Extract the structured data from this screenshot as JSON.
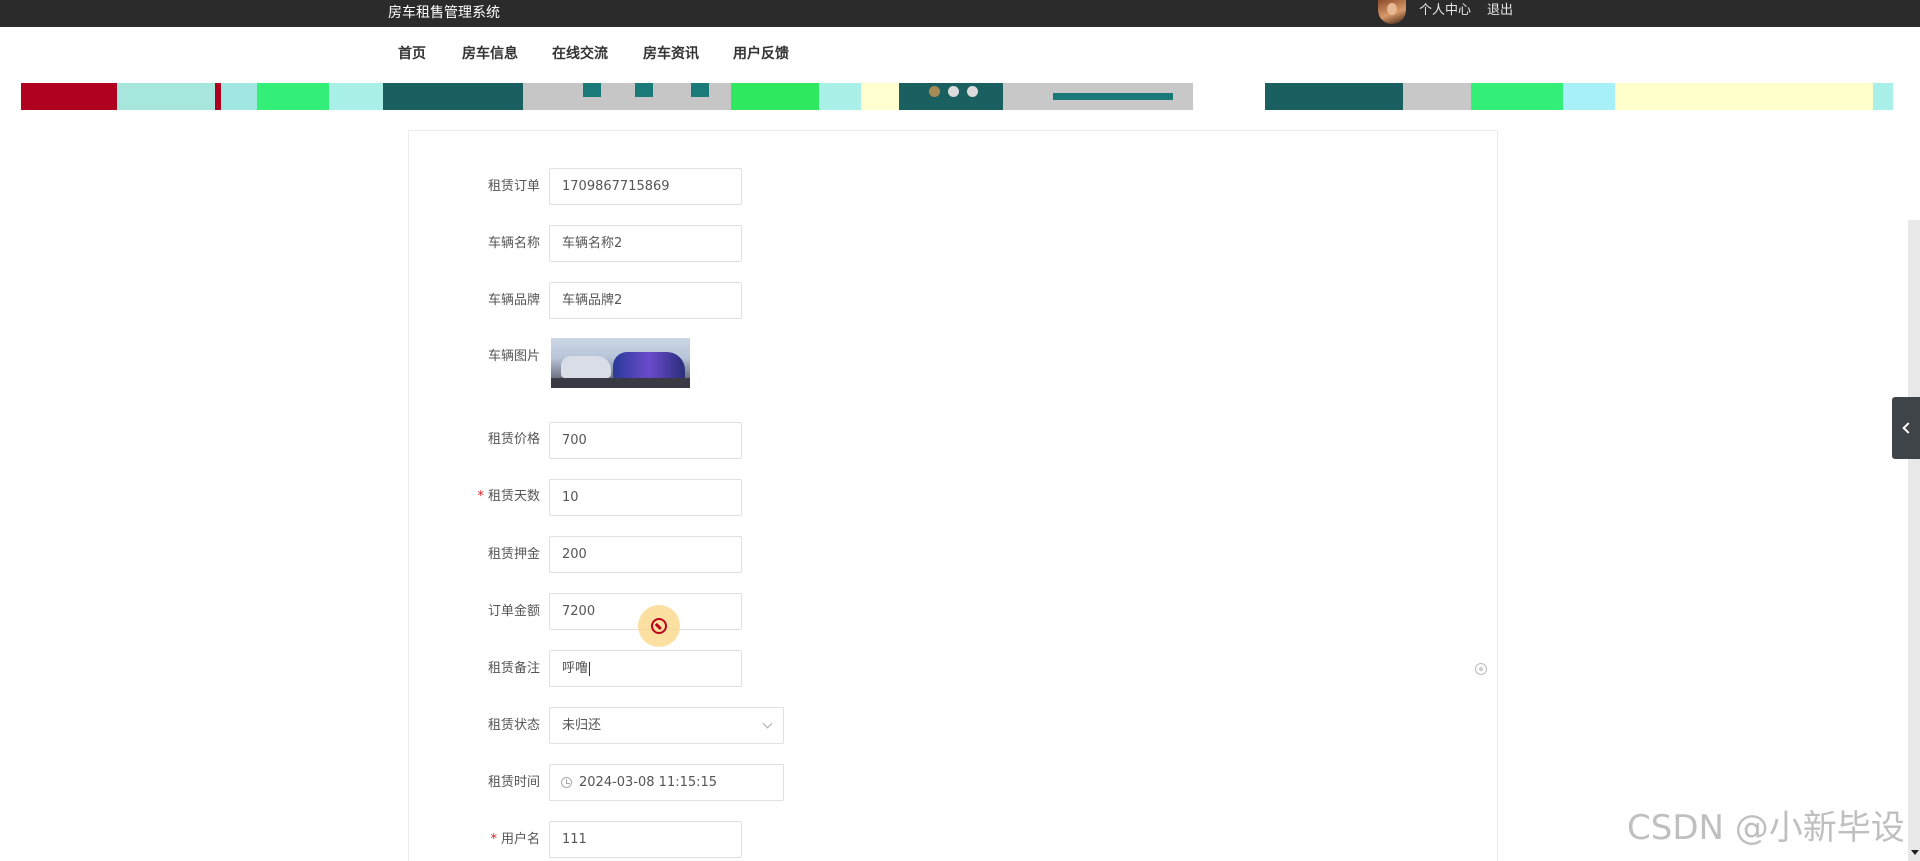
{
  "topbar": {
    "system_title": "房车租售管理系统",
    "personal_center": "个人中心",
    "logout": "退出"
  },
  "nav": {
    "items": [
      "首页",
      "房车信息",
      "在线交流",
      "房车资讯",
      "用户反馈"
    ]
  },
  "banner": {
    "dots": 3,
    "active_dot": 0
  },
  "form": {
    "fields": [
      {
        "label": "租赁订单",
        "value": "1709867715869",
        "required": false
      },
      {
        "label": "车辆名称",
        "value": "车辆名称2",
        "required": false
      },
      {
        "label": "车辆品牌",
        "value": "车辆品牌2",
        "required": false
      },
      {
        "label": "车辆图片",
        "required": false
      },
      {
        "label": "租赁价格",
        "value": "700",
        "required": false
      },
      {
        "label": "租赁天数",
        "value": "10",
        "required": true
      },
      {
        "label": "租赁押金",
        "value": "200",
        "required": false
      },
      {
        "label": "订单金额",
        "value": "7200",
        "required": false
      },
      {
        "label": "租赁备注",
        "value": "呼噜",
        "required": false
      },
      {
        "label": "租赁状态",
        "value": "未归还",
        "required": false
      },
      {
        "label": "租赁时间",
        "value": "2024-03-08 11:15:15",
        "required": false
      },
      {
        "label": "用户名",
        "value": "111",
        "required": true
      }
    ],
    "required_mark": "*"
  },
  "watermark": "CSDN @小新毕设",
  "colors": {
    "topbar_bg": "#2b2b2b",
    "required": "#e02020",
    "active_dot": "#a58a55",
    "side_tab": "#3e4448"
  },
  "icons": {
    "select_arrow": "chevron-down-icon",
    "date": "clock-icon",
    "cursor": "forbidden-icon",
    "clear": "clear-icon",
    "side_tab": "chevron-left-icon"
  }
}
